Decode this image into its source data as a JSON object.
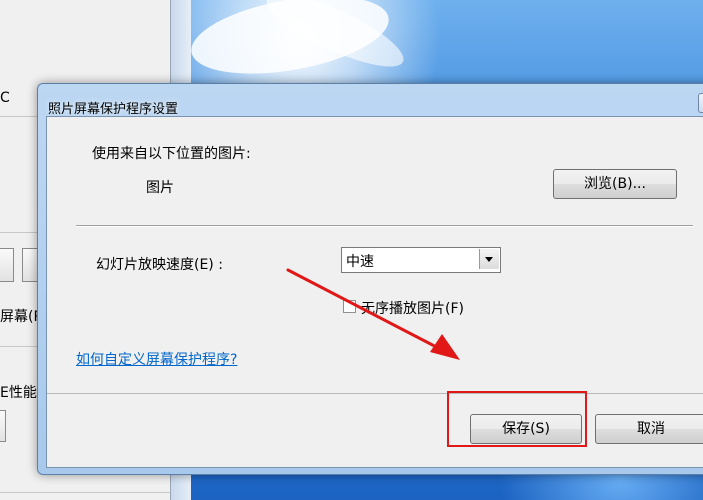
{
  "background_window": {
    "partial_texts": [
      "C",
      "屏幕(R",
      "E性能"
    ]
  },
  "dialog": {
    "title": "照片屏幕保护程序设置",
    "use_pictures_label": "使用来自以下位置的图片:",
    "folder_value": "图片",
    "browse_button": "浏览(B)...",
    "speed_label": "幻灯片放映速度(E) :",
    "speed_value": "中速",
    "shuffle_label": "无序播放图片(F)",
    "shuffle_checked": false,
    "help_link": "如何自定义屏幕保护程序?",
    "save_button": "保存(S)",
    "cancel_button": "取消"
  },
  "annotation": {
    "arrow_color": "#e01818",
    "highlight_color": "#e01818"
  }
}
